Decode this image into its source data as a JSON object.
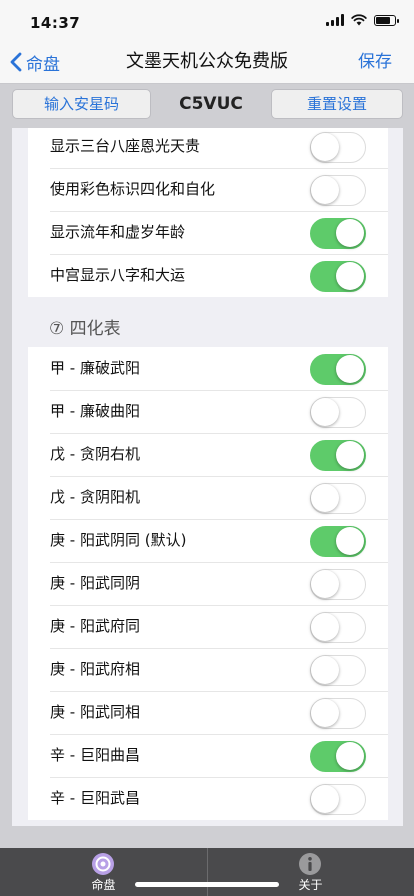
{
  "status_bar": {
    "time": "14:37"
  },
  "nav": {
    "back_label": "命盘",
    "title": "文墨天机公众免费版",
    "save_label": "保存"
  },
  "toolbar": {
    "left_button": "输入安星码",
    "code": "C5VUC",
    "right_button": "重置设置"
  },
  "settings_group_1": [
    {
      "label": "显示三台八座恩光天贵",
      "on": false
    },
    {
      "label": "使用彩色标识四化和自化",
      "on": false
    },
    {
      "label": "显示流年和虚岁年龄",
      "on": true
    },
    {
      "label": "中宫显示八字和大运",
      "on": true
    }
  ],
  "sihua_section": {
    "header": "⑦ 四化表",
    "items": [
      {
        "label": "甲 - 廉破武阳",
        "on": true
      },
      {
        "label": "甲 - 廉破曲阳",
        "on": false
      },
      {
        "label": "戊 - 贪阴右机",
        "on": true
      },
      {
        "label": "戊 - 贪阴阳机",
        "on": false
      },
      {
        "label": "庚 - 阳武阴同 (默认)",
        "on": true
      },
      {
        "label": "庚 - 阳武同阴",
        "on": false
      },
      {
        "label": "庚 - 阳武府同",
        "on": false
      },
      {
        "label": "庚 - 阳武府相",
        "on": false
      },
      {
        "label": "庚 - 阳武同相",
        "on": false
      },
      {
        "label": "辛 - 巨阳曲昌",
        "on": true
      },
      {
        "label": "辛 - 巨阳武昌",
        "on": false
      }
    ]
  },
  "tab_bar": {
    "tabs": [
      {
        "label": "命盘"
      },
      {
        "label": "关于"
      }
    ]
  },
  "colors": {
    "accent": "#2a73d8",
    "toggle_on": "#5ecb6a",
    "tab_bar": "#4a4a4c"
  }
}
